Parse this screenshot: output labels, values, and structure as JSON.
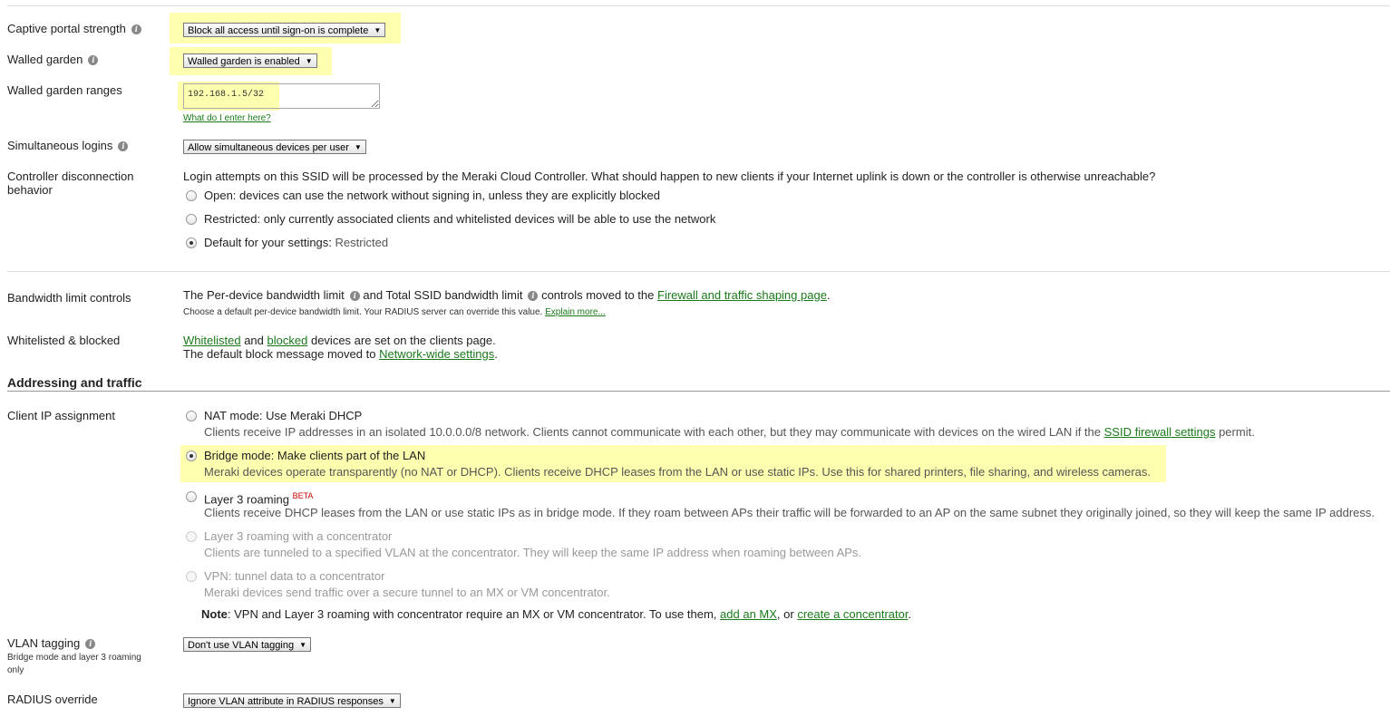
{
  "captive_portal": {
    "label": "Captive portal strength",
    "value": "Block all access until sign-on is complete"
  },
  "walled_garden": {
    "label": "Walled garden",
    "value": "Walled garden is enabled"
  },
  "walled_garden_ranges": {
    "label": "Walled garden ranges",
    "value": "192.168.1.5/32",
    "help_link": "What do I enter here?"
  },
  "simultaneous_logins": {
    "label": "Simultaneous logins",
    "value": "Allow simultaneous devices per user"
  },
  "controller_disconnection": {
    "label_line1": "Controller disconnection",
    "label_line2": "behavior",
    "intro": "Login attempts on this SSID will be processed by the Meraki Cloud Controller. What should happen to new clients if your Internet uplink is down or the controller is otherwise unreachable?",
    "options": [
      {
        "label": "Open: devices can use the network without signing in, unless they are explicitly blocked",
        "checked": false
      },
      {
        "label": "Restricted: only currently associated clients and whitelisted devices will be able to use the network",
        "checked": false
      },
      {
        "label": "Default for your settings:",
        "suffix": "Restricted",
        "checked": true
      }
    ]
  },
  "bandwidth": {
    "label": "Bandwidth limit controls",
    "text_a": "The Per-device bandwidth limit",
    "text_b": "and Total SSID bandwidth limit",
    "text_c": "controls moved to the",
    "link": "Firewall and traffic shaping page",
    "text_d": ".",
    "note": "Choose a default per-device bandwidth limit. Your RADIUS server can override this value.",
    "note_link": "Explain more..."
  },
  "whitelist": {
    "label": "Whitelisted & blocked",
    "link_whitelisted": "Whitelisted",
    "and": "and",
    "link_blocked": "blocked",
    "text_a": "devices are set on the clients page.",
    "text_b": "The default block message moved to",
    "link_network": "Network-wide settings",
    "text_c": "."
  },
  "addressing": {
    "title": "Addressing and traffic"
  },
  "client_ip": {
    "label": "Client IP assignment",
    "options": [
      {
        "title": "NAT mode: Use Meraki DHCP",
        "desc": "Clients receive IP addresses in an isolated 10.0.0.0/8 network. Clients cannot communicate with each other, but they may communicate with devices on the wired LAN if the",
        "desc_link": "SSID firewall settings",
        "desc_end": "permit.",
        "checked": false,
        "disabled": false
      },
      {
        "title": "Bridge mode: Make clients part of the LAN",
        "desc": "Meraki devices operate transparently (no NAT or DHCP). Clients receive DHCP leases from the LAN or use static IPs. Use this for shared printers, file sharing, and wireless cameras.",
        "checked": true,
        "disabled": false
      },
      {
        "title": "Layer 3 roaming",
        "badge": "BETA",
        "desc": "Clients receive DHCP leases from the LAN or use static IPs as in bridge mode. If they roam between APs their traffic will be forwarded to an AP on the same subnet they originally joined, so they will keep the same IP address.",
        "checked": false,
        "disabled": false
      },
      {
        "title": "Layer 3 roaming with a concentrator",
        "desc": "Clients are tunneled to a specified VLAN at the concentrator. They will keep the same IP address when roaming between APs.",
        "checked": false,
        "disabled": true
      },
      {
        "title": "VPN: tunnel data to a concentrator",
        "desc": "Meraki devices send traffic over a secure tunnel to an MX or VM concentrator.",
        "checked": false,
        "disabled": true
      }
    ],
    "note_bold": "Note",
    "note_text": ": VPN and Layer 3 roaming with concentrator require an MX or VM concentrator. To use them,",
    "note_link1": "add an MX",
    "note_mid": ", or",
    "note_link2": "create a concentrator",
    "note_end": "."
  },
  "vlan_tagging": {
    "label": "VLAN tagging",
    "sub_line1": "Bridge mode and layer 3 roaming",
    "sub_line2": "only",
    "value": "Don't use VLAN tagging"
  },
  "radius_override": {
    "label": "RADIUS override",
    "value": "Ignore VLAN attribute in RADIUS responses"
  },
  "colors": {
    "highlight": "#ffffb0",
    "link": "#1a7a1a",
    "beta": "#cc0000"
  }
}
